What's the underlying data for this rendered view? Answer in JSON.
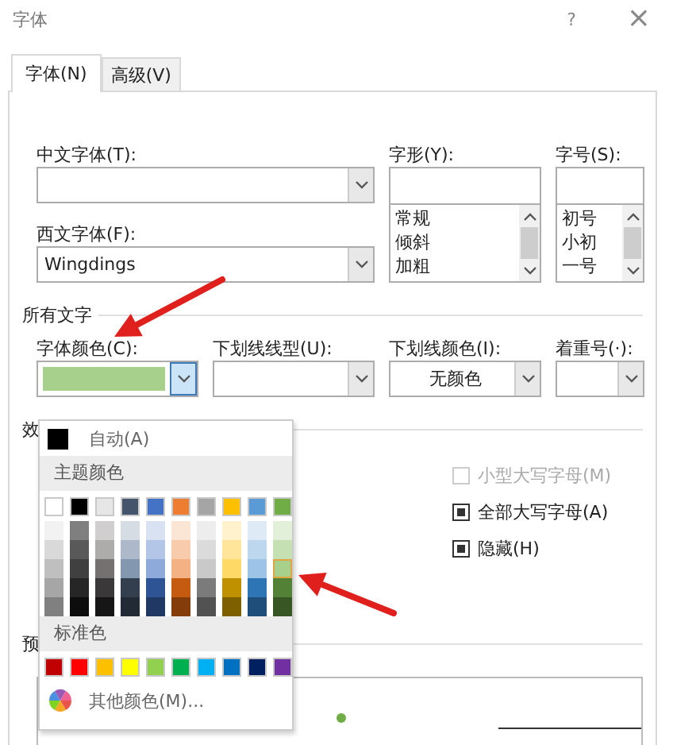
{
  "window": {
    "title": "字体",
    "help": "?",
    "close": "×"
  },
  "tabs": [
    {
      "label": "字体(N)",
      "selected": true
    },
    {
      "label": "高级(V)",
      "selected": false
    }
  ],
  "font_fields": {
    "chinese_font": {
      "label": "中文字体(T):"
    },
    "western_font": {
      "label": "西文字体(F):",
      "value": "Wingdings"
    },
    "style": {
      "label": "字形(Y):",
      "items": [
        "常规",
        "倾斜",
        "加粗"
      ]
    },
    "size": {
      "label": "字号(S):",
      "items": [
        "初号",
        "小初",
        "一号"
      ]
    }
  },
  "all_text": {
    "heading": "所有文字",
    "font_color": {
      "label": "字体颜色(C):",
      "color": "#a8d08d",
      "expanded": true
    },
    "underline_style": {
      "label": "下划线线型(U):"
    },
    "underline_color": {
      "label": "下划线颜色(I):",
      "value": "无颜色"
    },
    "emphasis": {
      "label": "着重号(·):"
    }
  },
  "effects": {
    "heading": "效",
    "options": [
      {
        "label": "小型大写字母(M)",
        "mixed": false,
        "disabled": true
      },
      {
        "label": "全部大写字母(A)",
        "mixed": true,
        "disabled": false
      },
      {
        "label": "隐藏(H)",
        "mixed": true,
        "disabled": false
      }
    ]
  },
  "preview": {
    "heading": "预",
    "color": "#70ad47"
  },
  "palette": {
    "auto": {
      "label": "自动(A)",
      "color": "#000000"
    },
    "theme_heading": "主题颜色",
    "theme_rows": [
      {
        "swatches": [
          {
            "color": "#ffffff",
            "selected": false
          },
          {
            "color": "#000000",
            "selected": false
          },
          {
            "color": "#e7e6e6",
            "selected": false
          },
          {
            "color": "#44546a",
            "selected": false
          },
          {
            "color": "#4472c4",
            "selected": false
          },
          {
            "color": "#ed7d31",
            "selected": false
          },
          {
            "color": "#a5a5a5",
            "selected": false
          },
          {
            "color": "#ffc000",
            "selected": false
          },
          {
            "color": "#5b9bd5",
            "selected": false
          },
          {
            "color": "#70ad47",
            "selected": false
          }
        ]
      },
      {
        "swatches": [
          {
            "color": "#f2f2f2",
            "selected": false
          },
          {
            "color": "#7f7f7f",
            "selected": false
          },
          {
            "color": "#d0cece",
            "selected": false
          },
          {
            "color": "#d6dce4",
            "selected": false
          },
          {
            "color": "#d9e2f3",
            "selected": false
          },
          {
            "color": "#fbe5d5",
            "selected": false
          },
          {
            "color": "#ededed",
            "selected": false
          },
          {
            "color": "#fff2cc",
            "selected": false
          },
          {
            "color": "#deebf6",
            "selected": false
          },
          {
            "color": "#e2efd9",
            "selected": false
          }
        ]
      },
      {
        "swatches": [
          {
            "color": "#d9d9d9",
            "selected": false
          },
          {
            "color": "#595959",
            "selected": false
          },
          {
            "color": "#aeabab",
            "selected": false
          },
          {
            "color": "#adb9ca",
            "selected": false
          },
          {
            "color": "#b4c6e7",
            "selected": false
          },
          {
            "color": "#f7cbac",
            "selected": false
          },
          {
            "color": "#dbdbdb",
            "selected": false
          },
          {
            "color": "#ffe599",
            "selected": false
          },
          {
            "color": "#bdd7ee",
            "selected": false
          },
          {
            "color": "#c5e0b3",
            "selected": false
          }
        ]
      },
      {
        "swatches": [
          {
            "color": "#bfbfbf",
            "selected": false
          },
          {
            "color": "#404040",
            "selected": false
          },
          {
            "color": "#757171",
            "selected": false
          },
          {
            "color": "#8497b0",
            "selected": false
          },
          {
            "color": "#8eaadb",
            "selected": false
          },
          {
            "color": "#f4b183",
            "selected": false
          },
          {
            "color": "#c9c9c9",
            "selected": false
          },
          {
            "color": "#ffd966",
            "selected": false
          },
          {
            "color": "#9dc3e6",
            "selected": false
          },
          {
            "color": "#a8d08d",
            "selected": true
          }
        ]
      },
      {
        "swatches": [
          {
            "color": "#a6a6a6",
            "selected": false
          },
          {
            "color": "#262626",
            "selected": false
          },
          {
            "color": "#3a3838",
            "selected": false
          },
          {
            "color": "#333f4f",
            "selected": false
          },
          {
            "color": "#2f5496",
            "selected": false
          },
          {
            "color": "#c55a11",
            "selected": false
          },
          {
            "color": "#7b7b7b",
            "selected": false
          },
          {
            "color": "#bf9000",
            "selected": false
          },
          {
            "color": "#2e75b5",
            "selected": false
          },
          {
            "color": "#538135",
            "selected": false
          }
        ]
      },
      {
        "swatches": [
          {
            "color": "#808080",
            "selected": false
          },
          {
            "color": "#0d0d0d",
            "selected": false
          },
          {
            "color": "#171616",
            "selected": false
          },
          {
            "color": "#222a35",
            "selected": false
          },
          {
            "color": "#1f3864",
            "selected": false
          },
          {
            "color": "#843c0b",
            "selected": false
          },
          {
            "color": "#525252",
            "selected": false
          },
          {
            "color": "#7f6000",
            "selected": false
          },
          {
            "color": "#1e4e79",
            "selected": false
          },
          {
            "color": "#375623",
            "selected": false
          }
        ]
      }
    ],
    "standard_heading": "标准色",
    "standard": [
      {
        "color": "#c00000",
        "selected": false
      },
      {
        "color": "#ff0000",
        "selected": false
      },
      {
        "color": "#ffc000",
        "selected": false
      },
      {
        "color": "#ffff00",
        "selected": false
      },
      {
        "color": "#92d050",
        "selected": false
      },
      {
        "color": "#00b050",
        "selected": false
      },
      {
        "color": "#00b0f0",
        "selected": false
      },
      {
        "color": "#0070c0",
        "selected": false
      },
      {
        "color": "#002060",
        "selected": false
      },
      {
        "color": "#7030a0",
        "selected": false
      }
    ],
    "more": "其他颜色(M)..."
  },
  "annotations": [
    {
      "kind": "arrow"
    },
    {
      "kind": "arrow"
    }
  ]
}
